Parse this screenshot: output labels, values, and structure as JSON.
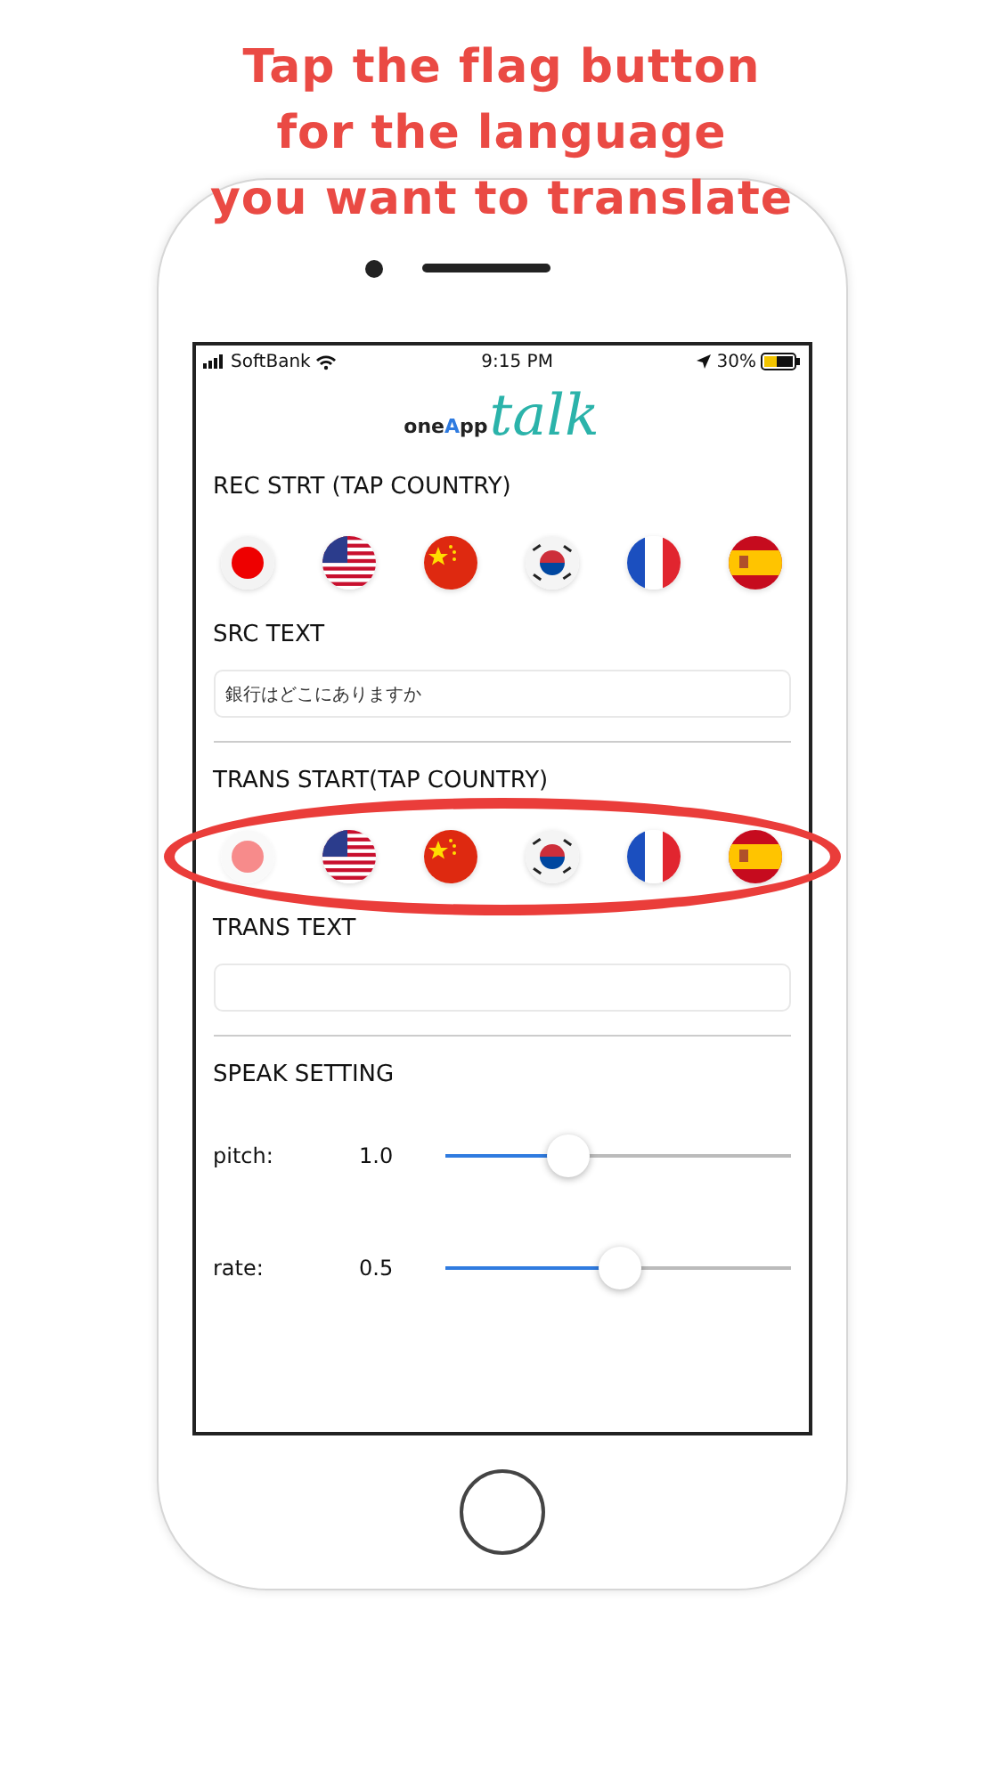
{
  "headline": [
    "Tap the flag button",
    "for the language",
    "you want to translate"
  ],
  "status_bar": {
    "carrier": "SoftBank",
    "time": "9:15 PM",
    "battery": "30%"
  },
  "logo": {
    "prefix": "oneApp",
    "script": "talk"
  },
  "rec_section": {
    "title": "REC STRT (TAP COUNTRY)",
    "flags": [
      {
        "kind": "jp",
        "disabled": false
      },
      {
        "kind": "us",
        "disabled": false
      },
      {
        "kind": "cn",
        "disabled": false
      },
      {
        "kind": "kr",
        "disabled": false
      },
      {
        "kind": "fr",
        "disabled": false
      },
      {
        "kind": "es",
        "disabled": false
      }
    ]
  },
  "src_text": {
    "title": "SRC TEXT",
    "value": "銀行はどこにありますか"
  },
  "trans_section": {
    "title": "TRANS START(TAP COUNTRY)",
    "highlighted": true,
    "flags": [
      {
        "kind": "jp",
        "disabled": true
      },
      {
        "kind": "us",
        "disabled": false
      },
      {
        "kind": "cn",
        "disabled": false
      },
      {
        "kind": "kr",
        "disabled": false
      },
      {
        "kind": "fr",
        "disabled": false
      },
      {
        "kind": "es",
        "disabled": false
      }
    ]
  },
  "trans_text": {
    "title": "TRANS TEXT"
  },
  "speak_setting": {
    "title": "SPEAK SETTING",
    "sliders": [
      {
        "label": "pitch:",
        "reading": "1.0",
        "level": 0.36
      },
      {
        "label": "rate:",
        "reading": "0.5",
        "level": 0.51
      }
    ]
  }
}
